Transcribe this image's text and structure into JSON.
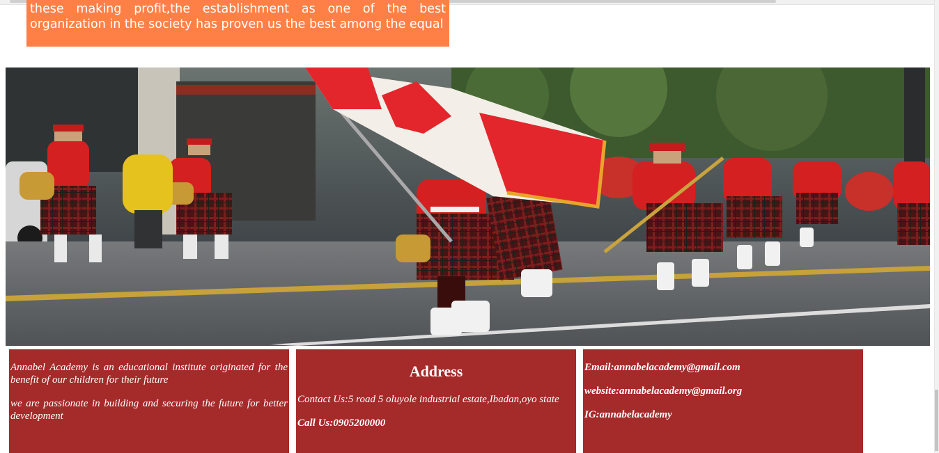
{
  "intro": {
    "line1": "these making profit,the establishment as one of the best",
    "line2": "organization in the society has proven us the best among the equal"
  },
  "hero": {
    "subject": "marching-band-parade-with-canadian-flag",
    "colors": {
      "uniform_red": "#d42020",
      "kilt": "#5a1818",
      "flag_red": "#e3262b",
      "road": "#5e6266"
    }
  },
  "footer": {
    "about": {
      "p1": "Annabel Academy is an educational institute originated for the benefit of our children for their future",
      "p2": "we are passionate in building and securing the future for better development"
    },
    "address": {
      "title": "Address",
      "contact": "Contact Us:5 road 5 oluyole industrial estate,Ibadan,oyo state",
      "call": "Call Us:0905200000"
    },
    "contacts": {
      "email": "Email:annabelacademy@gmail.com",
      "website": "website:annabelacademy@gmail.org",
      "ig": "IG:annabelacademy"
    },
    "box_color": "#a52a2a"
  },
  "intro_color": "#ff8047"
}
